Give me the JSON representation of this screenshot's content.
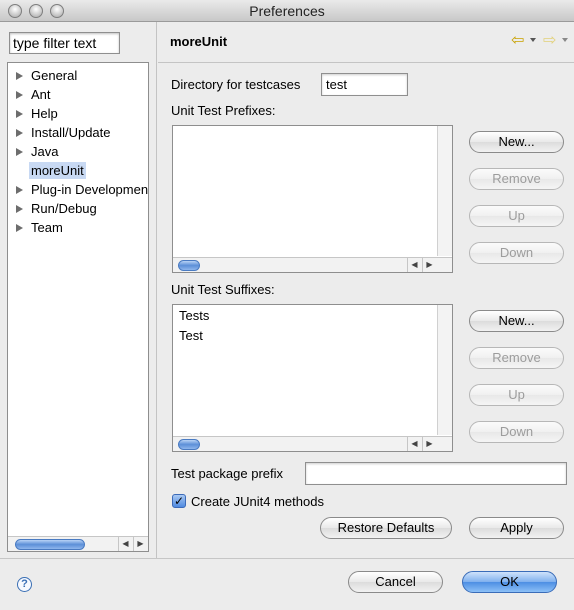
{
  "window": {
    "title": "Preferences"
  },
  "filter": {
    "value": "type filter text"
  },
  "tree": {
    "items": [
      {
        "label": "General",
        "expandable": true
      },
      {
        "label": "Ant",
        "expandable": true
      },
      {
        "label": "Help",
        "expandable": true
      },
      {
        "label": "Install/Update",
        "expandable": true
      },
      {
        "label": "Java",
        "expandable": true
      },
      {
        "label": "moreUnit",
        "expandable": false,
        "selected": true
      },
      {
        "label": "Plug-in Development",
        "expandable": true
      },
      {
        "label": "Run/Debug",
        "expandable": true
      },
      {
        "label": "Team",
        "expandable": true
      }
    ]
  },
  "page": {
    "title": "moreUnit",
    "directory_label": "Directory for testcases",
    "directory_value": "test",
    "prefixes_label": "Unit Test Prefixes:",
    "prefixes": [],
    "suffixes_label": "Unit Test Suffixes:",
    "suffixes": [
      "Tests",
      "Test"
    ],
    "package_prefix_label": "Test package prefix",
    "package_prefix_value": "",
    "junit4_label": "Create JUnit4 methods",
    "junit4_checked": true
  },
  "buttons": {
    "new": "New...",
    "remove": "Remove",
    "up": "Up",
    "down": "Down",
    "restore_defaults": "Restore Defaults",
    "apply": "Apply",
    "cancel": "Cancel",
    "ok": "OK",
    "help_icon_glyph": "?"
  },
  "icons": {
    "back": "arrow-left-icon",
    "forward": "arrow-right-icon",
    "checkmark_glyph": "✓"
  }
}
